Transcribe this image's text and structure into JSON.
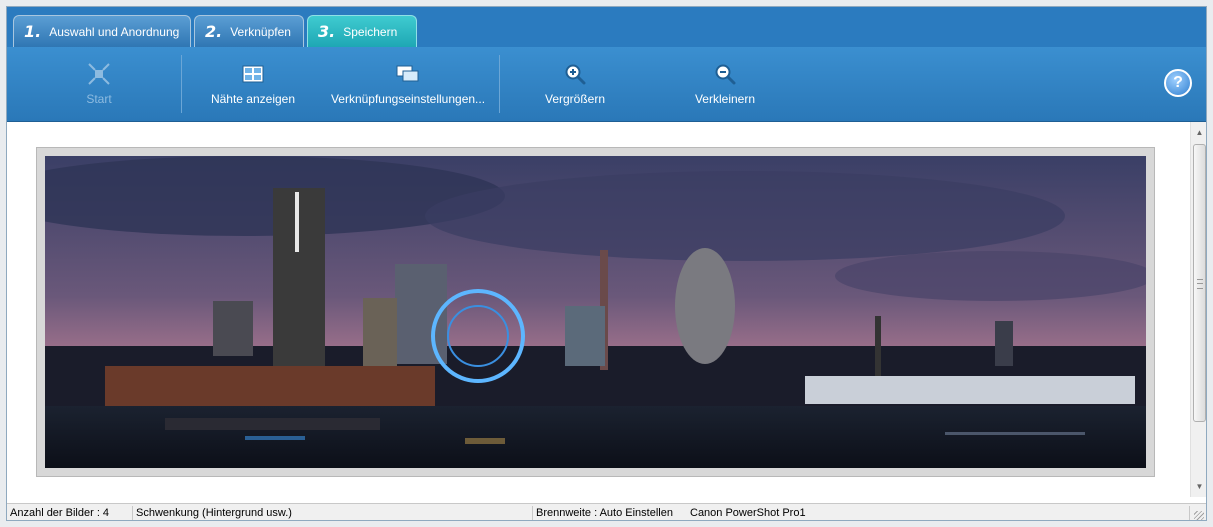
{
  "tabs": [
    {
      "num": "1.",
      "label": "Auswahl und Anordnung"
    },
    {
      "num": "2.",
      "label": "Verknüpfen"
    },
    {
      "num": "3.",
      "label": "Speichern"
    }
  ],
  "toolbar": {
    "start": "Start",
    "seams": "Nähte anzeigen",
    "settings": "Verknüpfungseinstellungen...",
    "zoom_in": "Vergrößern",
    "zoom_out": "Verkleinern",
    "help": "?"
  },
  "status": {
    "count": "Anzahl der Bilder : 4",
    "mode": "Schwenkung (Hintergrund usw.)",
    "focal": "Brennweite : Auto Einstellen",
    "camera": "Canon PowerShot Pro1"
  },
  "colors": {
    "accent": "#2b7bbf",
    "tab_active": "#1ea7b4"
  },
  "icons": {
    "start": "start-icon",
    "seams": "seams-icon",
    "settings": "settings-icon",
    "zoom_in": "zoom-in-icon",
    "zoom_out": "zoom-out-icon",
    "help": "help-icon"
  }
}
